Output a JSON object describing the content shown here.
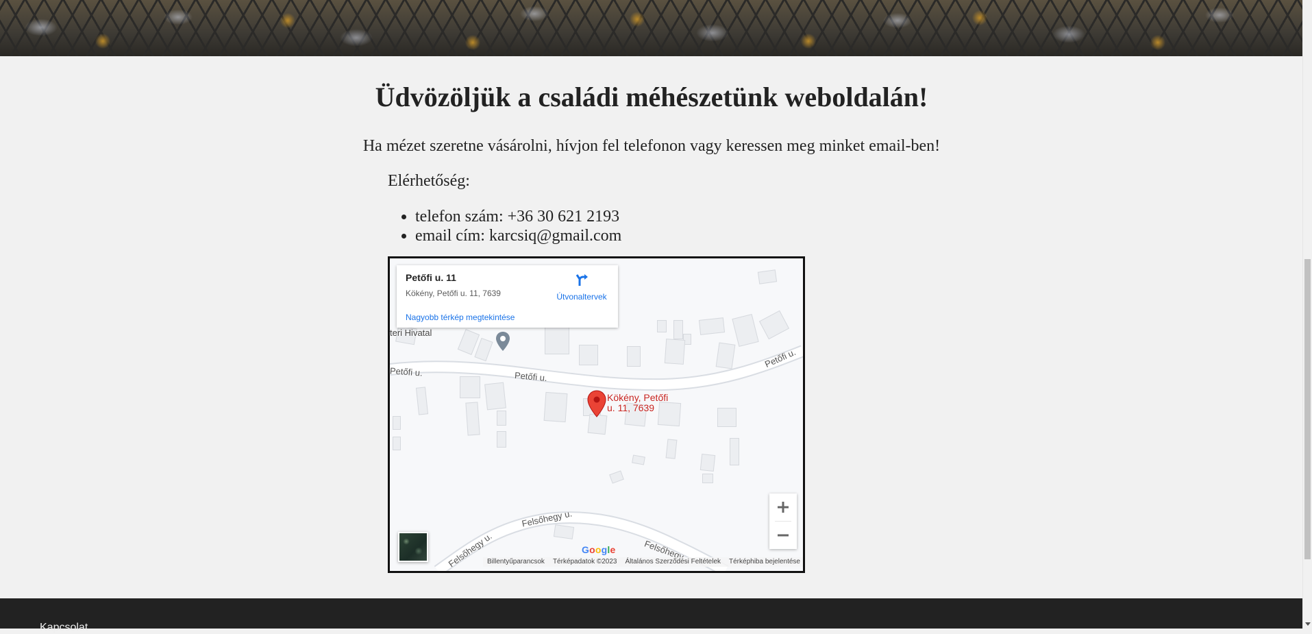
{
  "page": {
    "heading": "Üdvözöljük a családi méhészetünk weboldalán!",
    "intro": "Ha mézet szeretne vásárolni, hívjon fel telefonon vagy keressen meg minket email-ben!",
    "contact_heading": "Elérhetőség:",
    "contacts": [
      "telefon szám: +36 30 621 2193",
      "email cím: karcsiq@gmail.com"
    ]
  },
  "map": {
    "card": {
      "title": "Petőfi u. 11",
      "address": "Kökény, Petőfi u. 11, 7639",
      "larger_map_link": "Nagyobb térkép megtekintése",
      "directions_label": "Útvonaltervek"
    },
    "poi_label": "teri Hivatal",
    "road_labels": [
      "Petőfi u.",
      "Petőfi u.",
      "Petőfi u.",
      "Felsőhegy u.",
      "Felsőhegy u.",
      "Felsőhegy..."
    ],
    "pin_label": "Kökény, Petőfi u. 11, 7639",
    "footer_links": [
      "Billentyűparancsok",
      "Térképadatok ©2023",
      "Általános Szerződési Feltételek",
      "Térképhiba bejelentése"
    ],
    "brand": "Google",
    "colors": {
      "pin": "#ea4335",
      "link": "#1a73e8",
      "pin_label": "#c5221f"
    }
  },
  "footer": {
    "label": "Kapcsolat"
  }
}
